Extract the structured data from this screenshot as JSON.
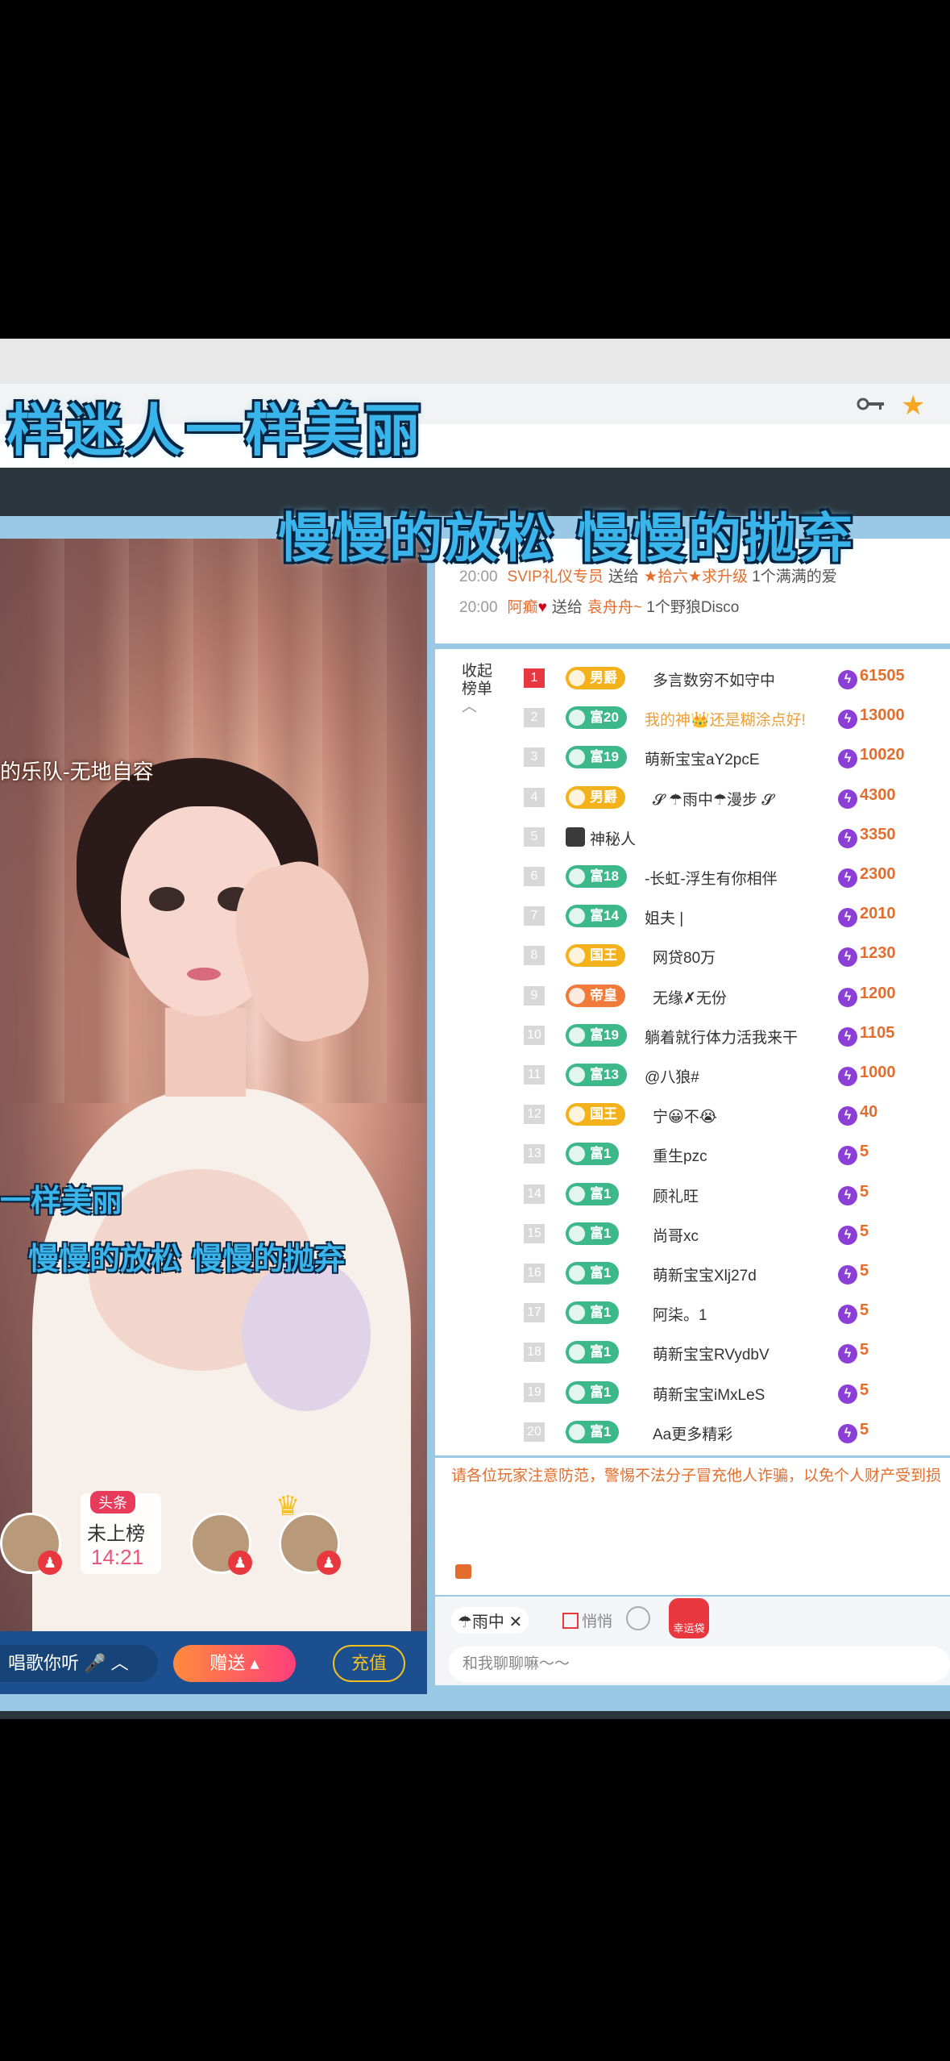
{
  "lyrics": {
    "line_top": "样迷人一样美丽",
    "line_second": "慢慢的放松  慢慢的抛弃",
    "video_line1": "一样美丽",
    "video_line2": "慢慢的放松  慢慢的抛弃"
  },
  "song_name": "的乐队-无地自容",
  "gift_feed": [
    {
      "time": "20:00",
      "user": "SVIP礼仪专员",
      "action": "送给",
      "target": "★拾六★求升级",
      "gift": "1个满满的爱"
    },
    {
      "time": "20:00",
      "user": "阿癫",
      "action": "送给",
      "target": "袁舟舟~",
      "gift": "1个野狼Disco"
    }
  ],
  "rank_panel": {
    "collapse_label": "收起榜单",
    "rows": [
      {
        "rank": "1",
        "badge": "男爵",
        "badge_color": "#f3b21b",
        "name": "多言数穷不如守中",
        "score": "61505"
      },
      {
        "rank": "2",
        "badge": "富20",
        "badge_color": "#3cb88a",
        "name": "我的神👑还是糊涂点好!",
        "score": "13000"
      },
      {
        "rank": "3",
        "badge": "富19",
        "badge_color": "#3cb88a",
        "name": "萌新宝宝aY2pcE",
        "score": "10020"
      },
      {
        "rank": "4",
        "badge": "男爵",
        "badge_color": "#f3b21b",
        "name": "𝓢 ☂雨中☂漫步 𝓢",
        "score": "4300"
      },
      {
        "rank": "5",
        "badge": "",
        "badge_color": "",
        "name": "神秘人",
        "score": "3350"
      },
      {
        "rank": "6",
        "badge": "富18",
        "badge_color": "#3cb88a",
        "name": "-长虹-浮生有你相伴",
        "score": "2300"
      },
      {
        "rank": "7",
        "badge": "富14",
        "badge_color": "#3cb88a",
        "name": "姐夫 |",
        "score": "2010"
      },
      {
        "rank": "8",
        "badge": "国王",
        "badge_color": "#f3b21b",
        "name": "网贷80万",
        "score": "1230"
      },
      {
        "rank": "9",
        "badge": "帝皇",
        "badge_color": "#f07a3a",
        "name": "无缘✗无份",
        "score": "1200"
      },
      {
        "rank": "10",
        "badge": "富19",
        "badge_color": "#3cb88a",
        "name": "躺着就行体力活我来干",
        "score": "1105"
      },
      {
        "rank": "11",
        "badge": "富13",
        "badge_color": "#3cb88a",
        "name": "@八狼#",
        "score": "1000"
      },
      {
        "rank": "12",
        "badge": "国王",
        "badge_color": "#f3b21b",
        "name": "宁😀不😭",
        "score": "40"
      },
      {
        "rank": "13",
        "badge": "富1",
        "badge_color": "#3cb88a",
        "name": "重生pzc",
        "score": "5"
      },
      {
        "rank": "14",
        "badge": "富1",
        "badge_color": "#3cb88a",
        "name": "顾礼旺",
        "score": "5"
      },
      {
        "rank": "15",
        "badge": "富1",
        "badge_color": "#3cb88a",
        "name": "尚哥xc",
        "score": "5"
      },
      {
        "rank": "16",
        "badge": "富1",
        "badge_color": "#3cb88a",
        "name": "萌新宝宝Xlj27d",
        "score": "5"
      },
      {
        "rank": "17",
        "badge": "富1",
        "badge_color": "#3cb88a",
        "name": "阿柒。1",
        "score": "5"
      },
      {
        "rank": "18",
        "badge": "富1",
        "badge_color": "#3cb88a",
        "name": "萌新宝宝RVydbV",
        "score": "5"
      },
      {
        "rank": "19",
        "badge": "富1",
        "badge_color": "#3cb88a",
        "name": "萌新宝宝iMxLeS",
        "score": "5"
      },
      {
        "rank": "20",
        "badge": "富1",
        "badge_color": "#3cb88a",
        "name": "Aa更多精彩",
        "score": "5"
      }
    ]
  },
  "notice": "请各位玩家注意防范，警惕不法分子冒充他人诈骗，以免个人财产受到损",
  "chat": {
    "target": "☂雨中 ✕",
    "whisper_label": "悄悄",
    "lucky_bag_label": "幸运袋",
    "input_placeholder": "和我聊聊嘛～～"
  },
  "headline": {
    "tag": "头条",
    "status": "未上榜",
    "timer": "14:21"
  },
  "controls": {
    "song_label": "唱歌你听",
    "gift_label": "赠送",
    "recharge_label": "充值"
  },
  "colors": {
    "accent": "#e36d2d",
    "frame": "#9ac9e6",
    "lyric": "#3ab5ec"
  }
}
